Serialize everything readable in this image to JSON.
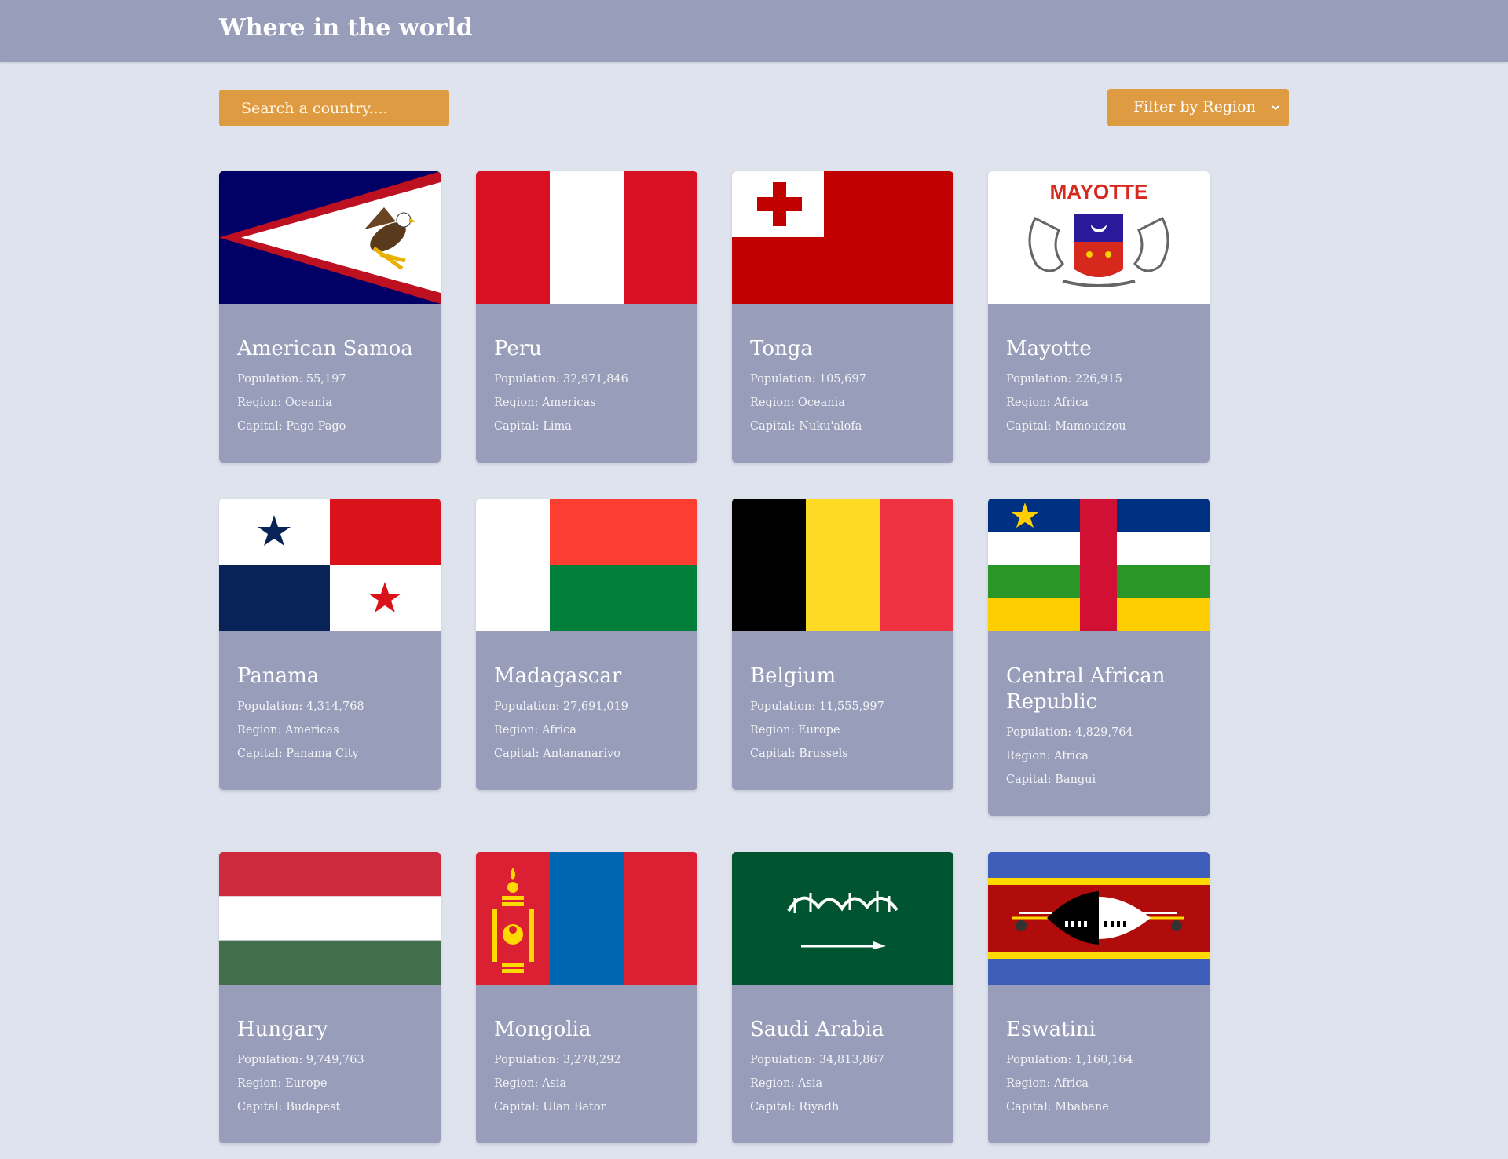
{
  "header": {
    "title": "Where in the world"
  },
  "search": {
    "placeholder": "Search a country...."
  },
  "filter": {
    "label": "Filter by Region"
  },
  "labels": {
    "population": "Population:",
    "region": "Region:",
    "capital": "Capital:"
  },
  "countries": [
    {
      "name": "American Samoa",
      "population": "55,197",
      "region": "Oceania",
      "capital": "Pago Pago",
      "flag_icon": "american-samoa-flag-icon"
    },
    {
      "name": "Peru",
      "population": "32,971,846",
      "region": "Americas",
      "capital": "Lima",
      "flag_icon": "peru-flag-icon"
    },
    {
      "name": "Tonga",
      "population": "105,697",
      "region": "Oceania",
      "capital": "Nuku'alofa",
      "flag_icon": "tonga-flag-icon"
    },
    {
      "name": "Mayotte",
      "population": "226,915",
      "region": "Africa",
      "capital": "Mamoudzou",
      "flag_icon": "mayotte-flag-icon",
      "flag_text": "MAYOTTE"
    },
    {
      "name": "Panama",
      "population": "4,314,768",
      "region": "Americas",
      "capital": "Panama City",
      "flag_icon": "panama-flag-icon"
    },
    {
      "name": "Madagascar",
      "population": "27,691,019",
      "region": "Africa",
      "capital": "Antananarivo",
      "flag_icon": "madagascar-flag-icon"
    },
    {
      "name": "Belgium",
      "population": "11,555,997",
      "region": "Europe",
      "capital": "Brussels",
      "flag_icon": "belgium-flag-icon"
    },
    {
      "name": "Central African Republic",
      "population": "4,829,764",
      "region": "Africa",
      "capital": "Bangui",
      "flag_icon": "central-african-republic-flag-icon"
    },
    {
      "name": "Hungary",
      "population": "9,749,763",
      "region": "Europe",
      "capital": "Budapest",
      "flag_icon": "hungary-flag-icon"
    },
    {
      "name": "Mongolia",
      "population": "3,278,292",
      "region": "Asia",
      "capital": "Ulan Bator",
      "flag_icon": "mongolia-flag-icon"
    },
    {
      "name": "Saudi Arabia",
      "population": "34,813,867",
      "region": "Asia",
      "capital": "Riyadh",
      "flag_icon": "saudi-arabia-flag-icon"
    },
    {
      "name": "Eswatini",
      "population": "1,160,164",
      "region": "Africa",
      "capital": "Mbabane",
      "flag_icon": "eswatini-flag-icon"
    }
  ],
  "colors": {
    "page_background": "#dfe3ee",
    "header_background": "#989db9",
    "card_background": "#989db9",
    "accent": "#df9b41"
  }
}
